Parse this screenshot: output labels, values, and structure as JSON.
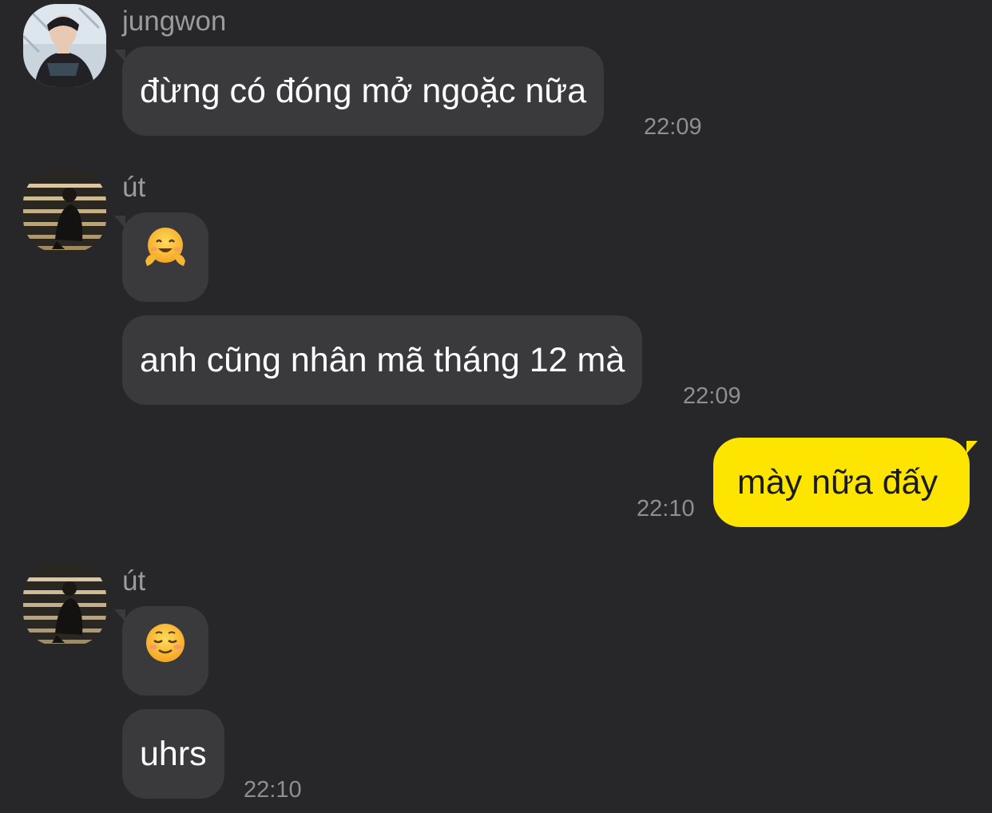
{
  "messages": [
    {
      "sender": "jungwon",
      "text": "đừng có đóng mở ngoặc nữa",
      "time": "22:09"
    },
    {
      "sender": "út",
      "emoji": "hugging-face-emoji"
    },
    {
      "text": "anh cũng nhân mã tháng 12 mà",
      "time": "22:09"
    },
    {
      "outgoing": true,
      "text": "mày nữa đấy",
      "time": "22:10"
    },
    {
      "sender": "út",
      "emoji": "smiling-face-emoji"
    },
    {
      "text": "uhrs",
      "time": "22:10"
    }
  ],
  "colors": {
    "background": "#272729",
    "incoming_bubble": "#3a3a3c",
    "outgoing_bubble": "#fee500",
    "timestamp": "#8e8e93",
    "sender_name": "#9a9a9f"
  }
}
